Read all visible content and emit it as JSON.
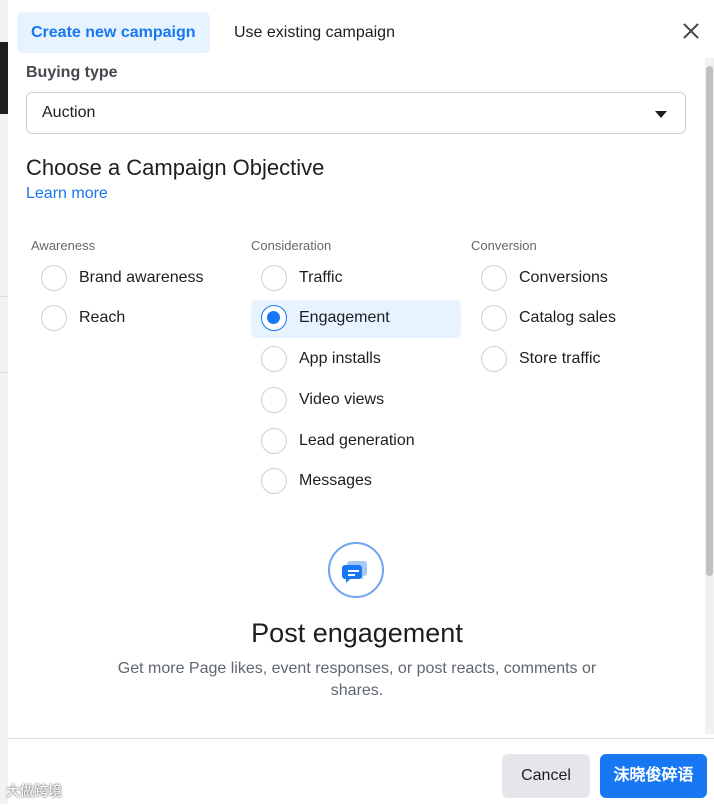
{
  "tabs": {
    "create_label": "Create new campaign",
    "existing_label": "Use existing campaign"
  },
  "buying_type": {
    "label": "Buying type",
    "value": "Auction"
  },
  "objective": {
    "title": "Choose a Campaign Objective",
    "learn_more": "Learn more"
  },
  "columns": [
    {
      "title": "Awareness",
      "options": [
        "Brand awareness",
        "Reach"
      ]
    },
    {
      "title": "Consideration",
      "options": [
        "Traffic",
        "Engagement",
        "App installs",
        "Video views",
        "Lead generation",
        "Messages"
      ]
    },
    {
      "title": "Conversion",
      "options": [
        "Conversions",
        "Catalog sales",
        "Store traffic"
      ]
    }
  ],
  "selected_option": "Engagement",
  "detail": {
    "icon": "chat-bubbles-icon",
    "title": "Post engagement",
    "description": "Get more Page likes, event responses, or post reacts, comments or shares."
  },
  "footer": {
    "cancel_label": "Cancel",
    "continue_label": "沫晓俊碎语"
  },
  "watermark": {
    "left_text": "大做跨境",
    "right_text": "沫晓俊碎语"
  },
  "colors": {
    "accent": "#1877f2",
    "accent_bg": "#e7f3ff",
    "text": "#1c1e21",
    "muted": "#65676b"
  }
}
